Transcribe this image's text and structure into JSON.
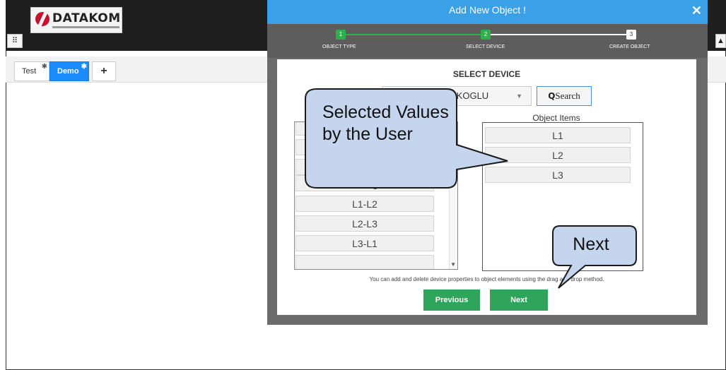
{
  "app": {
    "logo_text": "DATAKOM",
    "logo_subtext": "DATAKOM ELEKTRONIK MÜHENDISLIK LTD. STI.",
    "apps_icon": "grid-icon",
    "right_button_icon": "tree-icon",
    "tabs": [
      {
        "label": "Test",
        "active": false
      },
      {
        "label": "Demo",
        "active": true
      }
    ],
    "add_tab_label": "+"
  },
  "modal": {
    "title": "Add New Object !",
    "close_label": "✕",
    "steps": [
      {
        "number": "1",
        "label": "OBJECT TYPE",
        "state": "done"
      },
      {
        "number": "2",
        "label": "SELECT DEVICE",
        "state": "done"
      },
      {
        "number": "3",
        "label": "CREATE OBJECT",
        "state": "todo"
      }
    ],
    "panel_title": "SELECT DEVICE",
    "device_select_value": "AKOGLU",
    "search_icon": "Q",
    "search_label": "Search",
    "property_items": [
      "GSM Signal",
      "L1-L2",
      "L2-L3",
      "L3-L1"
    ],
    "object_items_title": "Object Items",
    "object_items": [
      "L1",
      "L2",
      "L3"
    ],
    "hint": "You can add and delete device properties to object elements using the drag and drop method.",
    "previous_label": "Previous",
    "next_label": "Next"
  },
  "callouts": {
    "selected_values": "Selected Values by the User",
    "next": "Next"
  },
  "colors": {
    "header_blue": "#3aa0e8",
    "step_green": "#2bb04a",
    "button_green": "#2ea55a",
    "tab_active_blue": "#1a8cff",
    "callout_fill": "#c5d5ee",
    "callout_stroke": "#1a1a1a"
  }
}
